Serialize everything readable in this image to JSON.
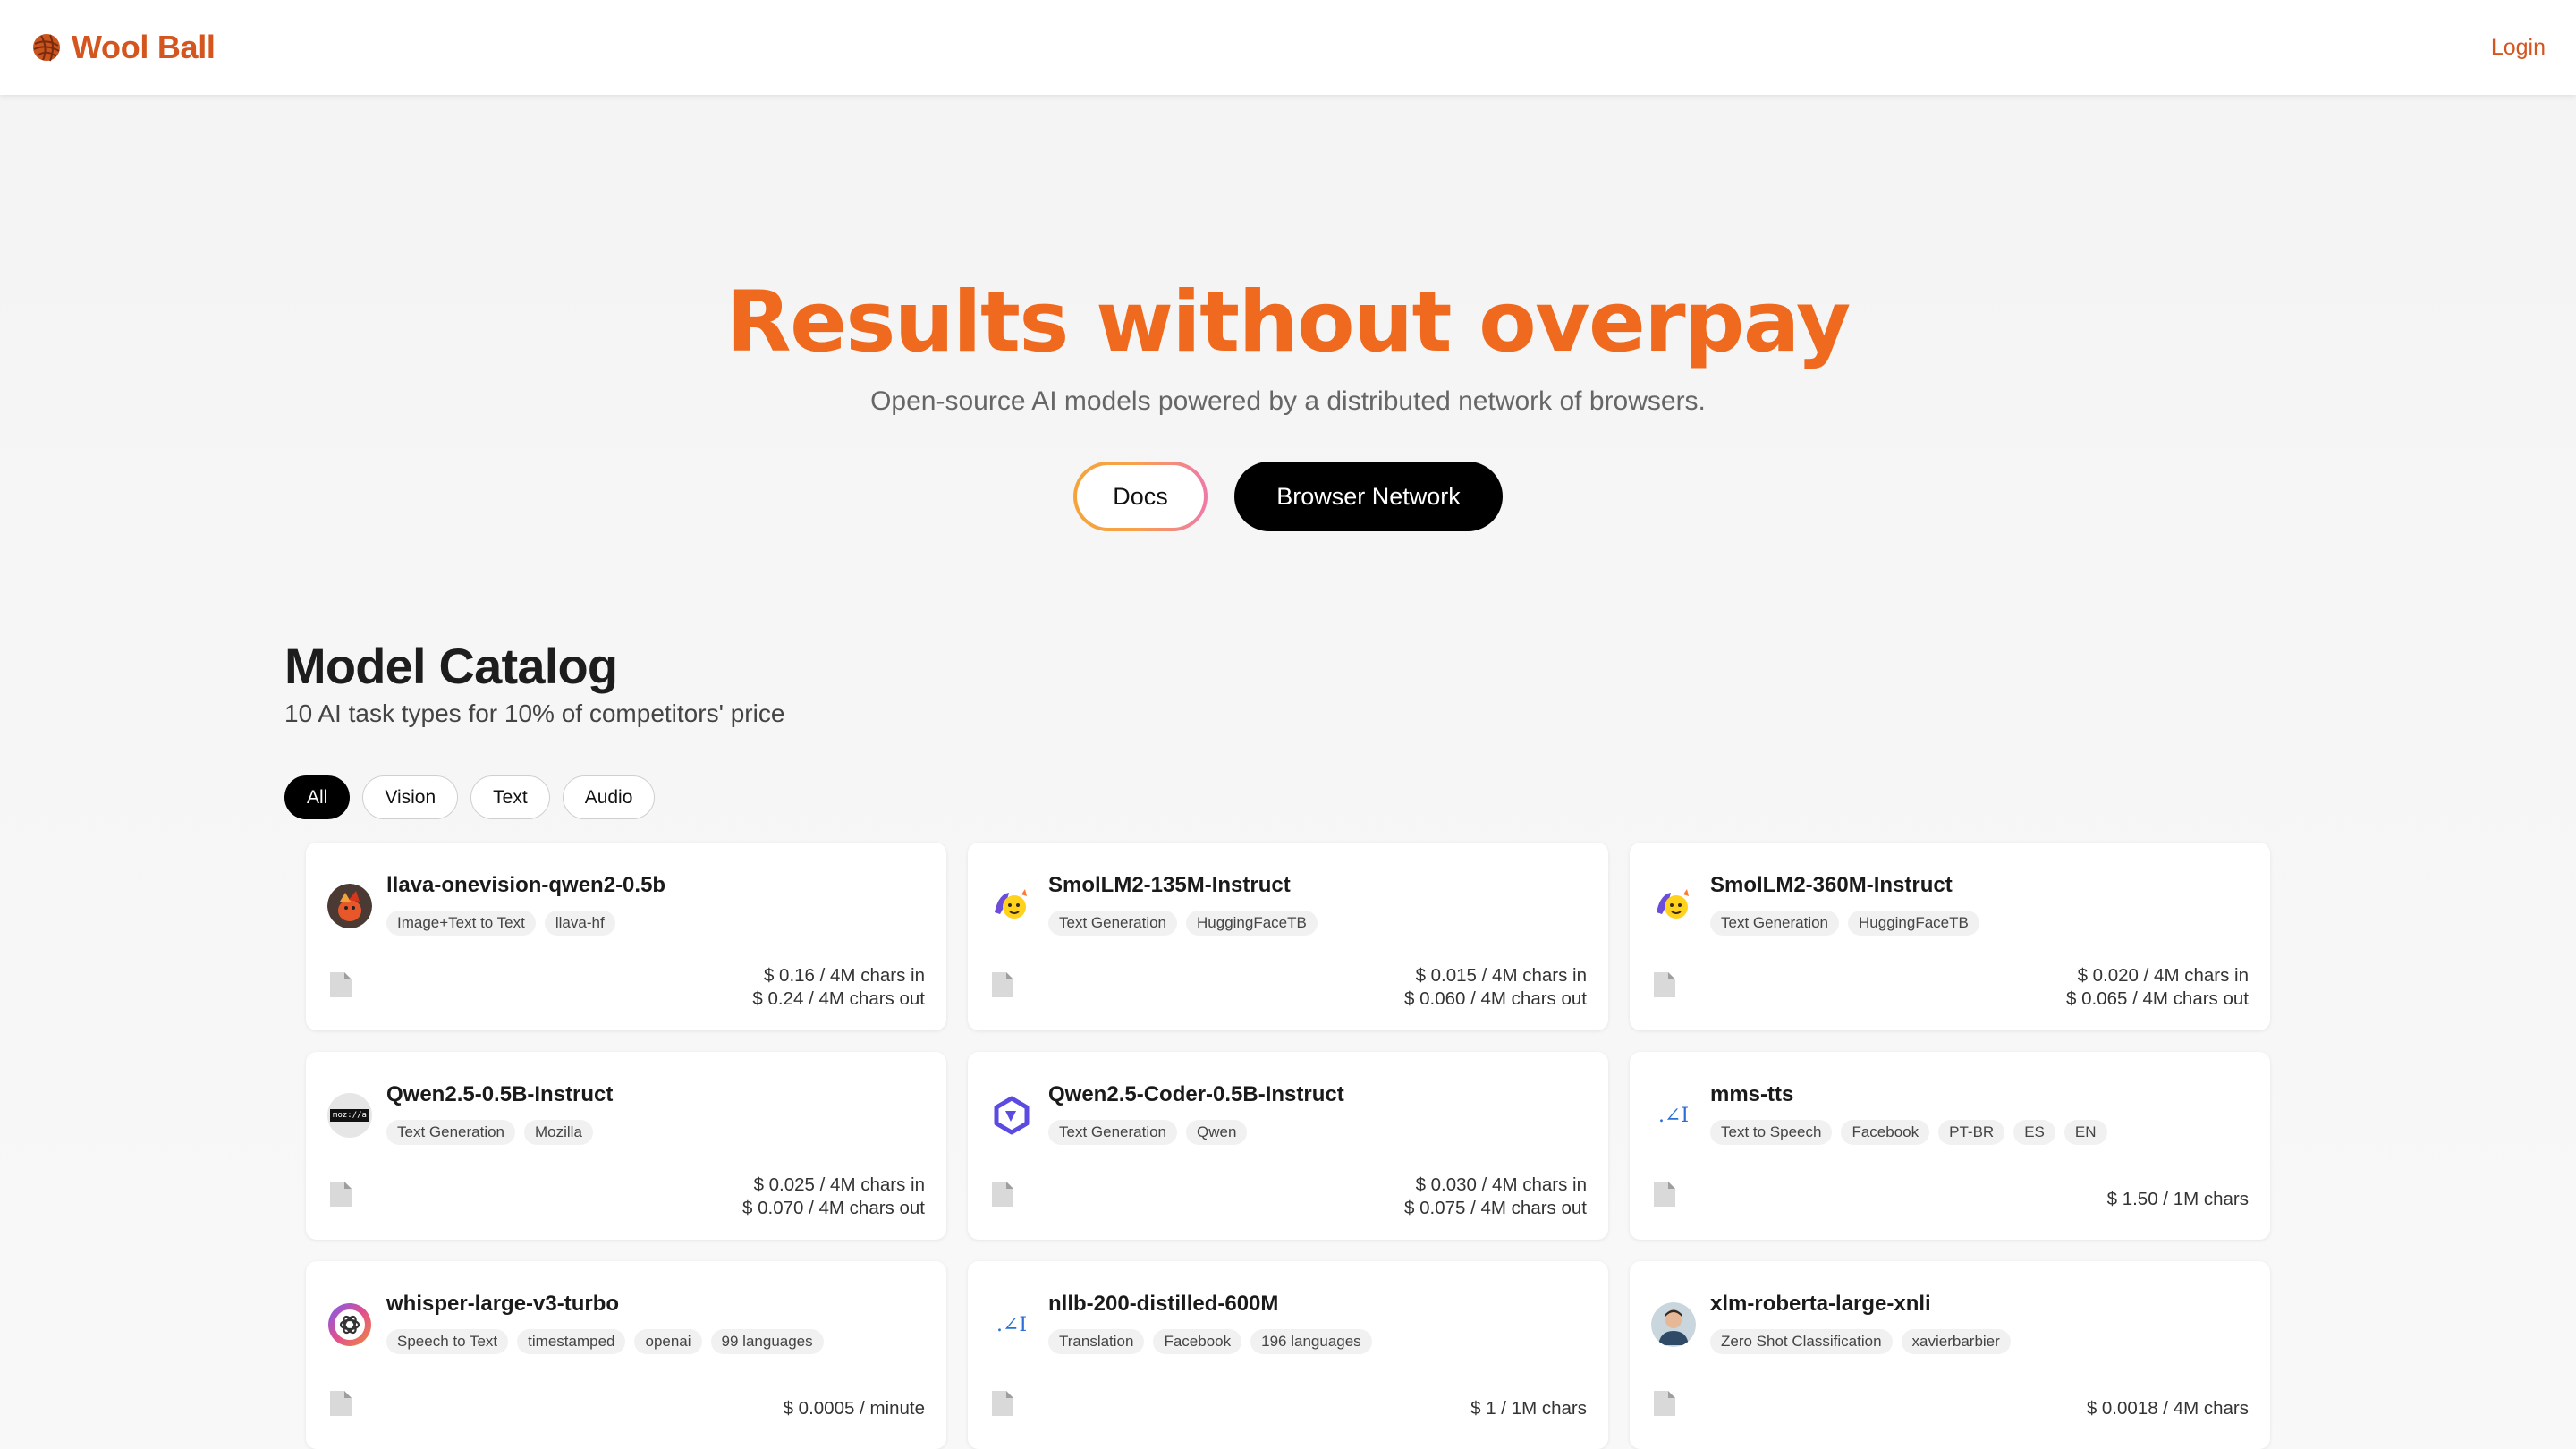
{
  "header": {
    "brand": "Wool Ball",
    "login": "Login"
  },
  "hero": {
    "title": "Results without overpay",
    "subtitle": "Open-source AI models powered by a distributed network of browsers.",
    "docs_button": "Docs",
    "network_button": "Browser Network"
  },
  "catalog": {
    "title": "Model Catalog",
    "subtitle": "10 AI task types for 10% of competitors' price",
    "filters": [
      "All",
      "Vision",
      "Text",
      "Audio"
    ],
    "active_filter": "All"
  },
  "colors": {
    "brand": "#d4561e",
    "hero_title": "#ef6a1e"
  },
  "models": [
    {
      "name": "llava-onevision-qwen2-0.5b",
      "avatar": "llava-avatar-icon",
      "tags": [
        "Image+Text to Text",
        "llava-hf"
      ],
      "price_lines": [
        "$ 0.16 / 4M chars in",
        "$ 0.24 / 4M chars out"
      ]
    },
    {
      "name": "SmolLM2-135M-Instruct",
      "avatar": "huggingface-avatar-icon",
      "tags": [
        "Text Generation",
        "HuggingFaceTB"
      ],
      "price_lines": [
        "$ 0.015 / 4M chars in",
        "$ 0.060 / 4M chars out"
      ]
    },
    {
      "name": "SmolLM2-360M-Instruct",
      "avatar": "huggingface-avatar-icon",
      "tags": [
        "Text Generation",
        "HuggingFaceTB"
      ],
      "price_lines": [
        "$ 0.020 / 4M chars in",
        "$ 0.065 / 4M chars out"
      ]
    },
    {
      "name": "Qwen2.5-0.5B-Instruct",
      "avatar": "mozilla-avatar-icon",
      "avatar_text": "moz://a",
      "tags": [
        "Text Generation",
        "Mozilla"
      ],
      "price_lines": [
        "$ 0.025 / 4M chars in",
        "$ 0.070 / 4M chars out"
      ]
    },
    {
      "name": "Qwen2.5-Coder-0.5B-Instruct",
      "avatar": "qwen-avatar-icon",
      "tags": [
        "Text Generation",
        "Qwen"
      ],
      "price_lines": [
        "$ 0.030 / 4M chars in",
        "$ 0.075 / 4M chars out"
      ]
    },
    {
      "name": "mms-tts",
      "avatar": "meta-ai-avatar-icon",
      "avatar_text": ".∠I",
      "tags": [
        "Text to Speech",
        "Facebook",
        "PT-BR",
        "ES",
        "EN"
      ],
      "price_lines": [
        "$ 1.50 / 1M chars"
      ]
    },
    {
      "name": "whisper-large-v3-turbo",
      "avatar": "openai-avatar-icon",
      "tags": [
        "Speech to Text",
        "timestamped",
        "openai",
        "99 languages"
      ],
      "price_lines": [
        "$ 0.0005 / minute"
      ]
    },
    {
      "name": "nllb-200-distilled-600M",
      "avatar": "meta-ai-avatar-icon",
      "avatar_text": ".∠I",
      "tags": [
        "Translation",
        "Facebook",
        "196 languages"
      ],
      "price_lines": [
        "$ 1 / 1M chars"
      ]
    },
    {
      "name": "xlm-roberta-large-xnli",
      "avatar": "person-avatar-icon",
      "tags": [
        "Zero Shot Classification",
        "xavierbarbier"
      ],
      "price_lines": [
        "$ 0.0018 / 4M chars"
      ]
    }
  ]
}
